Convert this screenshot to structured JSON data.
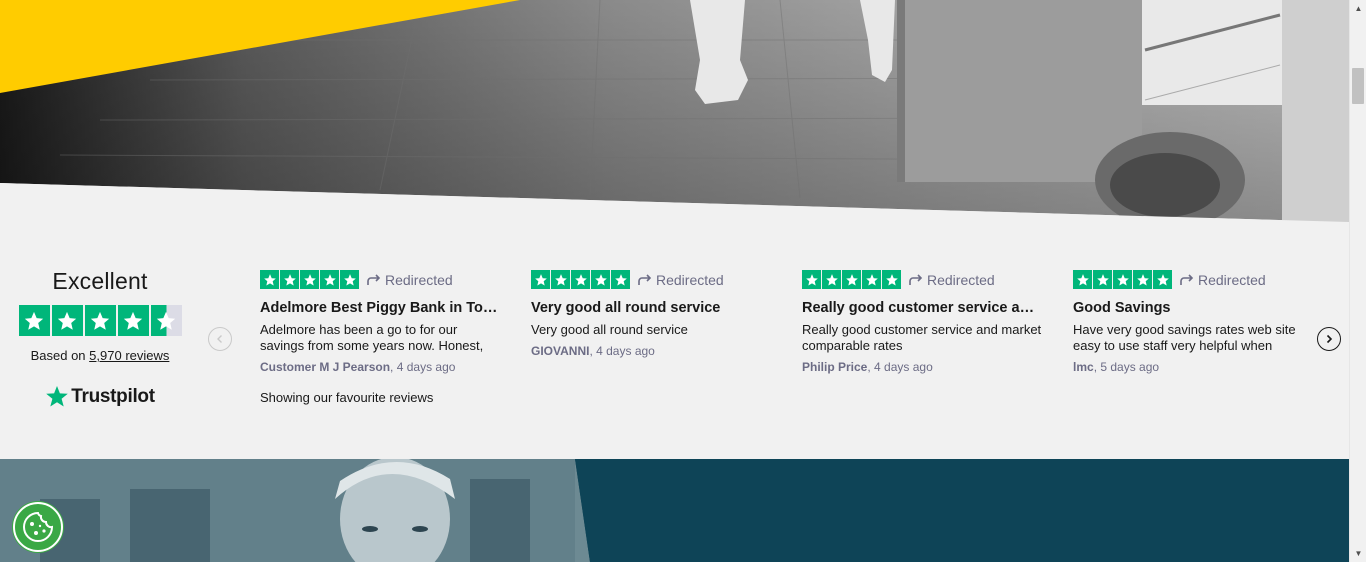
{
  "trustpilot": {
    "rating_word": "Excellent",
    "rating_stars": 4.5,
    "based_on_prefix": "Based on",
    "reviews_link": "5,970 reviews",
    "brand": "Trustpilot",
    "showing_text": "Showing our favourite reviews",
    "brand_color": "#00b67a"
  },
  "reviews": [
    {
      "stars": 5,
      "redirect_label": "Redirected",
      "title": "Adelmore Best Piggy Bank in Town",
      "text": "Adelmore has been a go to for our savings from some years now. Honest,",
      "author": "Customer M J Pearson",
      "age": "4 days ago"
    },
    {
      "stars": 5,
      "redirect_label": "Redirected",
      "title": "Very good all round service",
      "text": "Very good all round service",
      "author": "GIOVANNI",
      "age": "4 days ago"
    },
    {
      "stars": 5,
      "redirect_label": "Redirected",
      "title": "Really good customer service and market comparable rates",
      "text": "Really good customer service and market comparable rates",
      "author": "Philip Price",
      "age": "4 days ago"
    },
    {
      "stars": 5,
      "redirect_label": "Redirected",
      "title": "Good Savings",
      "text": "Have very good savings rates web site easy to use staff very helpful when",
      "author": "lmc",
      "age": "5 days ago"
    }
  ],
  "carousel": {
    "prev_icon": "chevron-left-icon",
    "next_icon": "chevron-right-icon"
  },
  "cookie": {
    "icon": "cookie-icon",
    "color": "#3aa845"
  },
  "theme": {
    "accent_yellow": "#ffcc00",
    "section_bg": "#f1f1f1",
    "teal": "#0e4457"
  }
}
